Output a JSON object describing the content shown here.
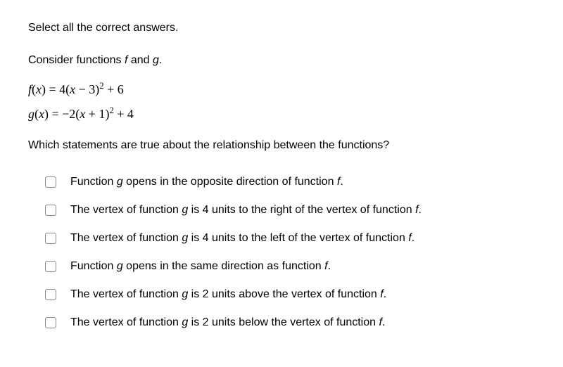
{
  "instruction": "Select all the correct answers.",
  "prompt_prefix": "Consider functions ",
  "prompt_f": "f",
  "prompt_mid": " and ",
  "prompt_g": "g",
  "prompt_suffix": ".",
  "eq1_lhs_func": "f",
  "eq1_lhs_open": "(",
  "eq1_lhs_var": "x",
  "eq1_lhs_close": ") = 4(",
  "eq1_var2": "x",
  "eq1_rest": " − 3)",
  "eq1_exp": "2",
  "eq1_tail": " + 6",
  "eq2_lhs_func": "g",
  "eq2_lhs_open": "(",
  "eq2_lhs_var": "x",
  "eq2_lhs_close": ") = −2(",
  "eq2_var2": "x",
  "eq2_rest": " + 1)",
  "eq2_exp": "2",
  "eq2_tail": " + 4",
  "question": "Which statements are true about the relationship between the functions?",
  "options": [
    {
      "pre": "Function ",
      "g": "g",
      "mid": " opens in the opposite direction of function ",
      "f": "f",
      "post": "."
    },
    {
      "pre": "The vertex of function ",
      "g": "g",
      "mid": " is 4 units to the right of the vertex of function ",
      "f": "f",
      "post": "."
    },
    {
      "pre": "The vertex of function ",
      "g": "g",
      "mid": " is 4 units to the left of the vertex of function ",
      "f": "f",
      "post": "."
    },
    {
      "pre": "Function ",
      "g": "g",
      "mid": " opens in the same direction as function ",
      "f": "f",
      "post": "."
    },
    {
      "pre": "The vertex of function ",
      "g": "g",
      "mid": " is 2 units above the vertex of function ",
      "f": "f",
      "post": "."
    },
    {
      "pre": "The vertex of function ",
      "g": "g",
      "mid": " is 2 units below the vertex of function ",
      "f": "f",
      "post": "."
    }
  ]
}
